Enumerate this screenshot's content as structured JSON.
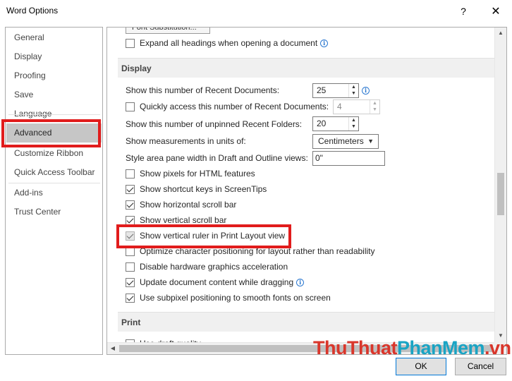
{
  "window": {
    "title": "Word Options",
    "help_label": "?",
    "close_label": "✕"
  },
  "sidebar": {
    "items": [
      {
        "label": "General"
      },
      {
        "label": "Display"
      },
      {
        "label": "Proofing"
      },
      {
        "label": "Save"
      },
      {
        "label": "Language"
      },
      {
        "label": "Advanced",
        "selected": true
      },
      {
        "label": "Customize Ribbon"
      },
      {
        "label": "Quick Access Toolbar"
      },
      {
        "label": "Add-ins"
      },
      {
        "label": "Trust Center"
      }
    ]
  },
  "content": {
    "font_substitution_label": "Font Substitution...",
    "expand_headings": {
      "label": "Expand all headings when opening a document",
      "checked": false
    },
    "display_section": "Display",
    "recent_docs": {
      "label": "Show this number of Recent Documents:",
      "value": "25"
    },
    "quick_access": {
      "label": "Quickly access this number of Recent Documents:",
      "value": "4",
      "checked": false
    },
    "recent_folders": {
      "label": "Show this number of unpinned Recent Folders:",
      "value": "20"
    },
    "measurements": {
      "label": "Show measurements in units of:",
      "value": "Centimeters"
    },
    "style_area": {
      "label": "Style area pane width in Draft and Outline views:",
      "value": "0\""
    },
    "checkboxes": [
      {
        "label": "Show pixels for HTML features",
        "checked": false
      },
      {
        "label": "Show shortcut keys in ScreenTips",
        "checked": true
      },
      {
        "label": "Show horizontal scroll bar",
        "checked": true
      },
      {
        "label": "Show vertical scroll bar",
        "checked": true
      },
      {
        "label": "Show vertical ruler in Print Layout view",
        "checked": true
      },
      {
        "label": "Optimize character positioning for layout rather than readability",
        "checked": false
      },
      {
        "label": "Disable hardware graphics acceleration",
        "checked": false
      },
      {
        "label": "Update document content while dragging",
        "checked": true
      },
      {
        "label": "Use subpixel positioning to smooth fonts on screen",
        "checked": true
      }
    ],
    "print_section": "Print",
    "draft_quality": {
      "label": "Use draft quality",
      "checked": false
    }
  },
  "buttons": {
    "ok": "OK",
    "cancel": "Cancel"
  },
  "watermark": {
    "part1": "ThuThuat",
    "part2": "PhanMem",
    "part3": ".vn"
  },
  "colors": {
    "highlight_red": "#e11c1c",
    "selected_bg": "#c6c6c6",
    "info_blue": "#2b78d0"
  }
}
